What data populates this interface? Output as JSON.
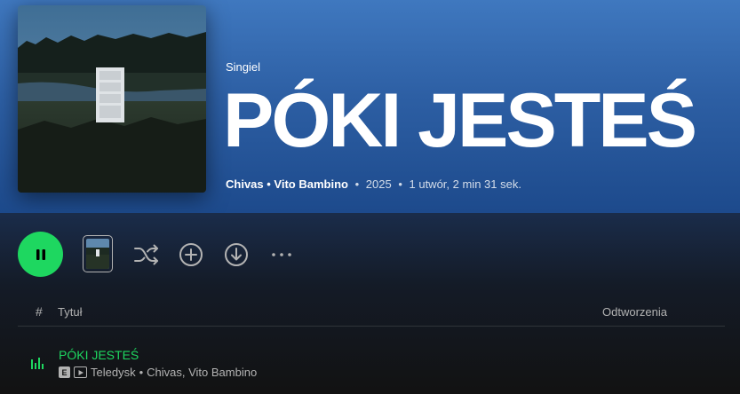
{
  "album": {
    "type_label": "Singiel",
    "title": "PÓKI JESTEŚ",
    "artists": "Chivas • Vito Bambino",
    "year": "2025",
    "summary": "1 utwór, 2 min 31 sek."
  },
  "actions": {
    "play_state": "pause",
    "icons": [
      "pause-icon",
      "video-thumbnail",
      "shuffle-icon",
      "add-icon",
      "download-icon",
      "more-icon"
    ]
  },
  "tracklist": {
    "headers": {
      "number": "#",
      "title": "Tytuł",
      "plays": "Odtworzenia"
    },
    "tracks": [
      {
        "title": "PÓKI JESTEŚ",
        "explicit_badge": "E",
        "type": "Teledysk",
        "artists": "Chivas, Vito Bambino",
        "playing": true
      }
    ]
  },
  "colors": {
    "accent": "#1ed760",
    "header_top": "#3f78bf",
    "header_bottom": "#1d4a8c",
    "background": "#121212"
  }
}
